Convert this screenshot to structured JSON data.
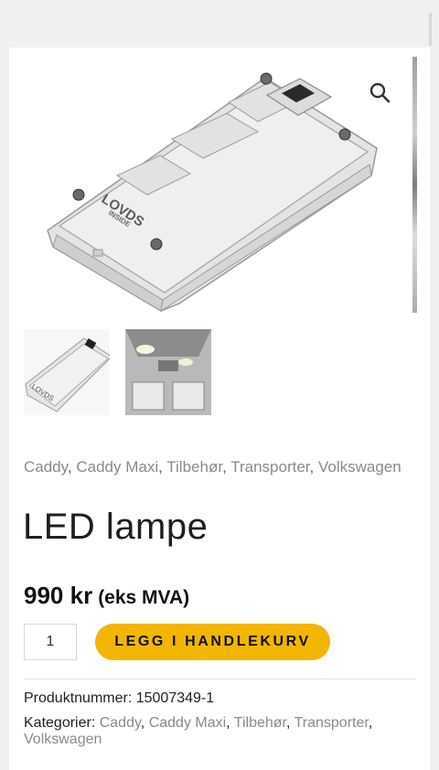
{
  "product": {
    "categories": [
      "Caddy",
      "Caddy Maxi",
      "Tilbehør",
      "Transporter",
      "Volkswagen"
    ],
    "category_separator": ",",
    "title": "LED lampe",
    "price": "990 kr",
    "vat_note": "(eks MVA)",
    "quantity": "1",
    "add_to_cart_label": "LEGG I HANDLEKURV",
    "sku_label": "Produktnummer:",
    "sku": "15007349-1",
    "categories_label": "Kategorier:"
  },
  "gallery": {
    "zoom_icon": "search-icon",
    "main_image": "led-lamp-housing",
    "thumbnails": [
      "led-lamp-housing",
      "van-interior-light"
    ]
  },
  "colors": {
    "accent": "#f2b600",
    "link": "#8a8a8a",
    "text": "#1f1f1f"
  }
}
